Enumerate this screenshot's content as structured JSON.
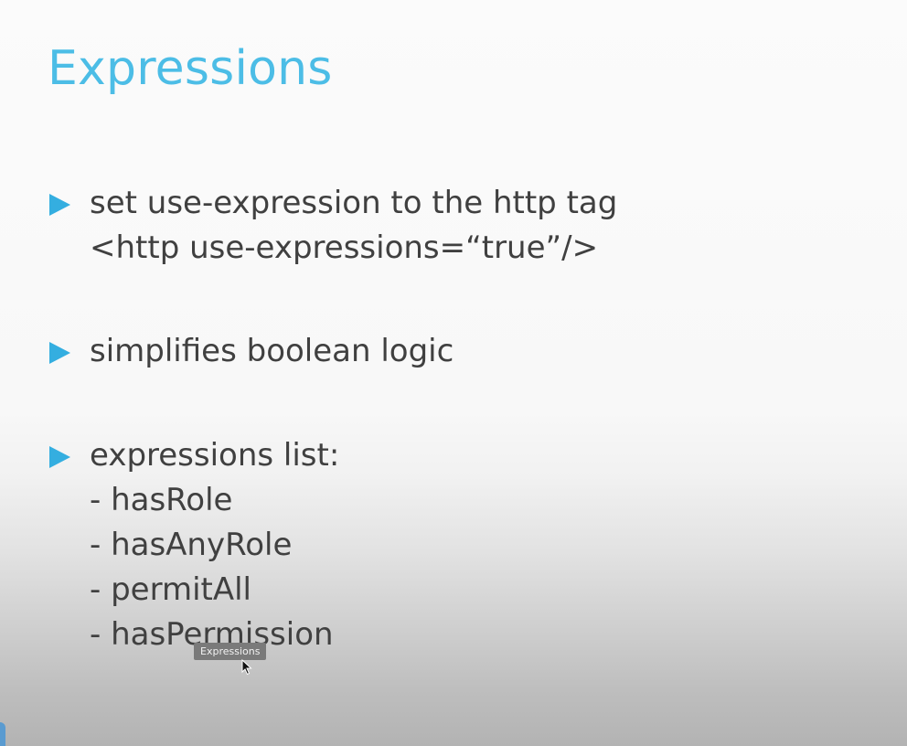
{
  "slide": {
    "title": "Expressions",
    "bullets": [
      {
        "lines": [
          "set use-expression to the http tag",
          "<http use-expressions=“true”/>"
        ]
      },
      {
        "lines": [
          "simplifies boolean logic"
        ]
      },
      {
        "lines": [
          "expressions list:",
          "- hasRole",
          "- hasAnyRole",
          "- permitAll",
          "- hasPermission"
        ]
      }
    ]
  },
  "tooltip": {
    "text": "Expressions"
  },
  "colors": {
    "title": "#4cbde6",
    "bullet_arrow": "#34aee0",
    "body_text": "#404040"
  },
  "icons": {
    "bullet": "triangle-right-icon",
    "pointer": "mouse-pointer-icon"
  }
}
